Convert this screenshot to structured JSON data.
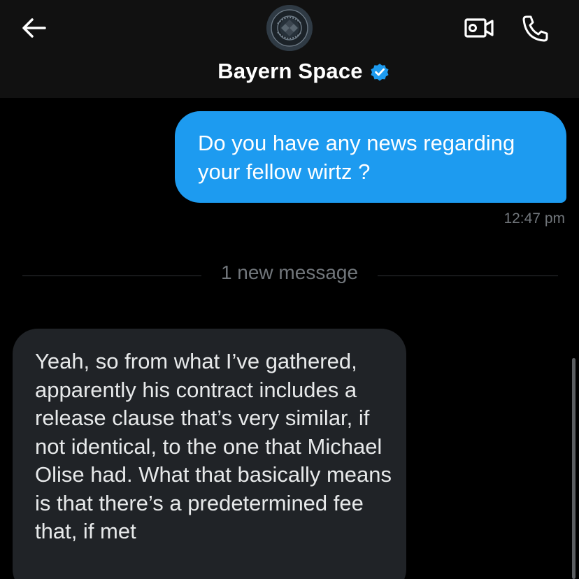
{
  "header": {
    "title": "Bayern Space",
    "back_icon": "arrow-left-icon",
    "avatar_icon": "bayern-logo-icon",
    "verified_icon": "verified-badge-icon",
    "video_icon": "video-call-icon",
    "phone_icon": "phone-call-icon"
  },
  "messages": {
    "outgoing": {
      "text": "Do you have any news regarding your fellow wirtz ?",
      "time": "12:47 pm"
    },
    "divider": "1 new message",
    "incoming": {
      "text": "Yeah, so from what I’ve gathered, apparently his contract includes a release clause that’s very similar, if not identical, to the one that Michael Olise had. What that basically means is that there’s a predetermined fee that, if met"
    }
  },
  "colors": {
    "background": "#000000",
    "header": "#111111",
    "outgoing_bubble": "#1d9bf0",
    "incoming_bubble": "#202327",
    "muted_text": "#71767b",
    "verified": "#1d9bf0"
  }
}
